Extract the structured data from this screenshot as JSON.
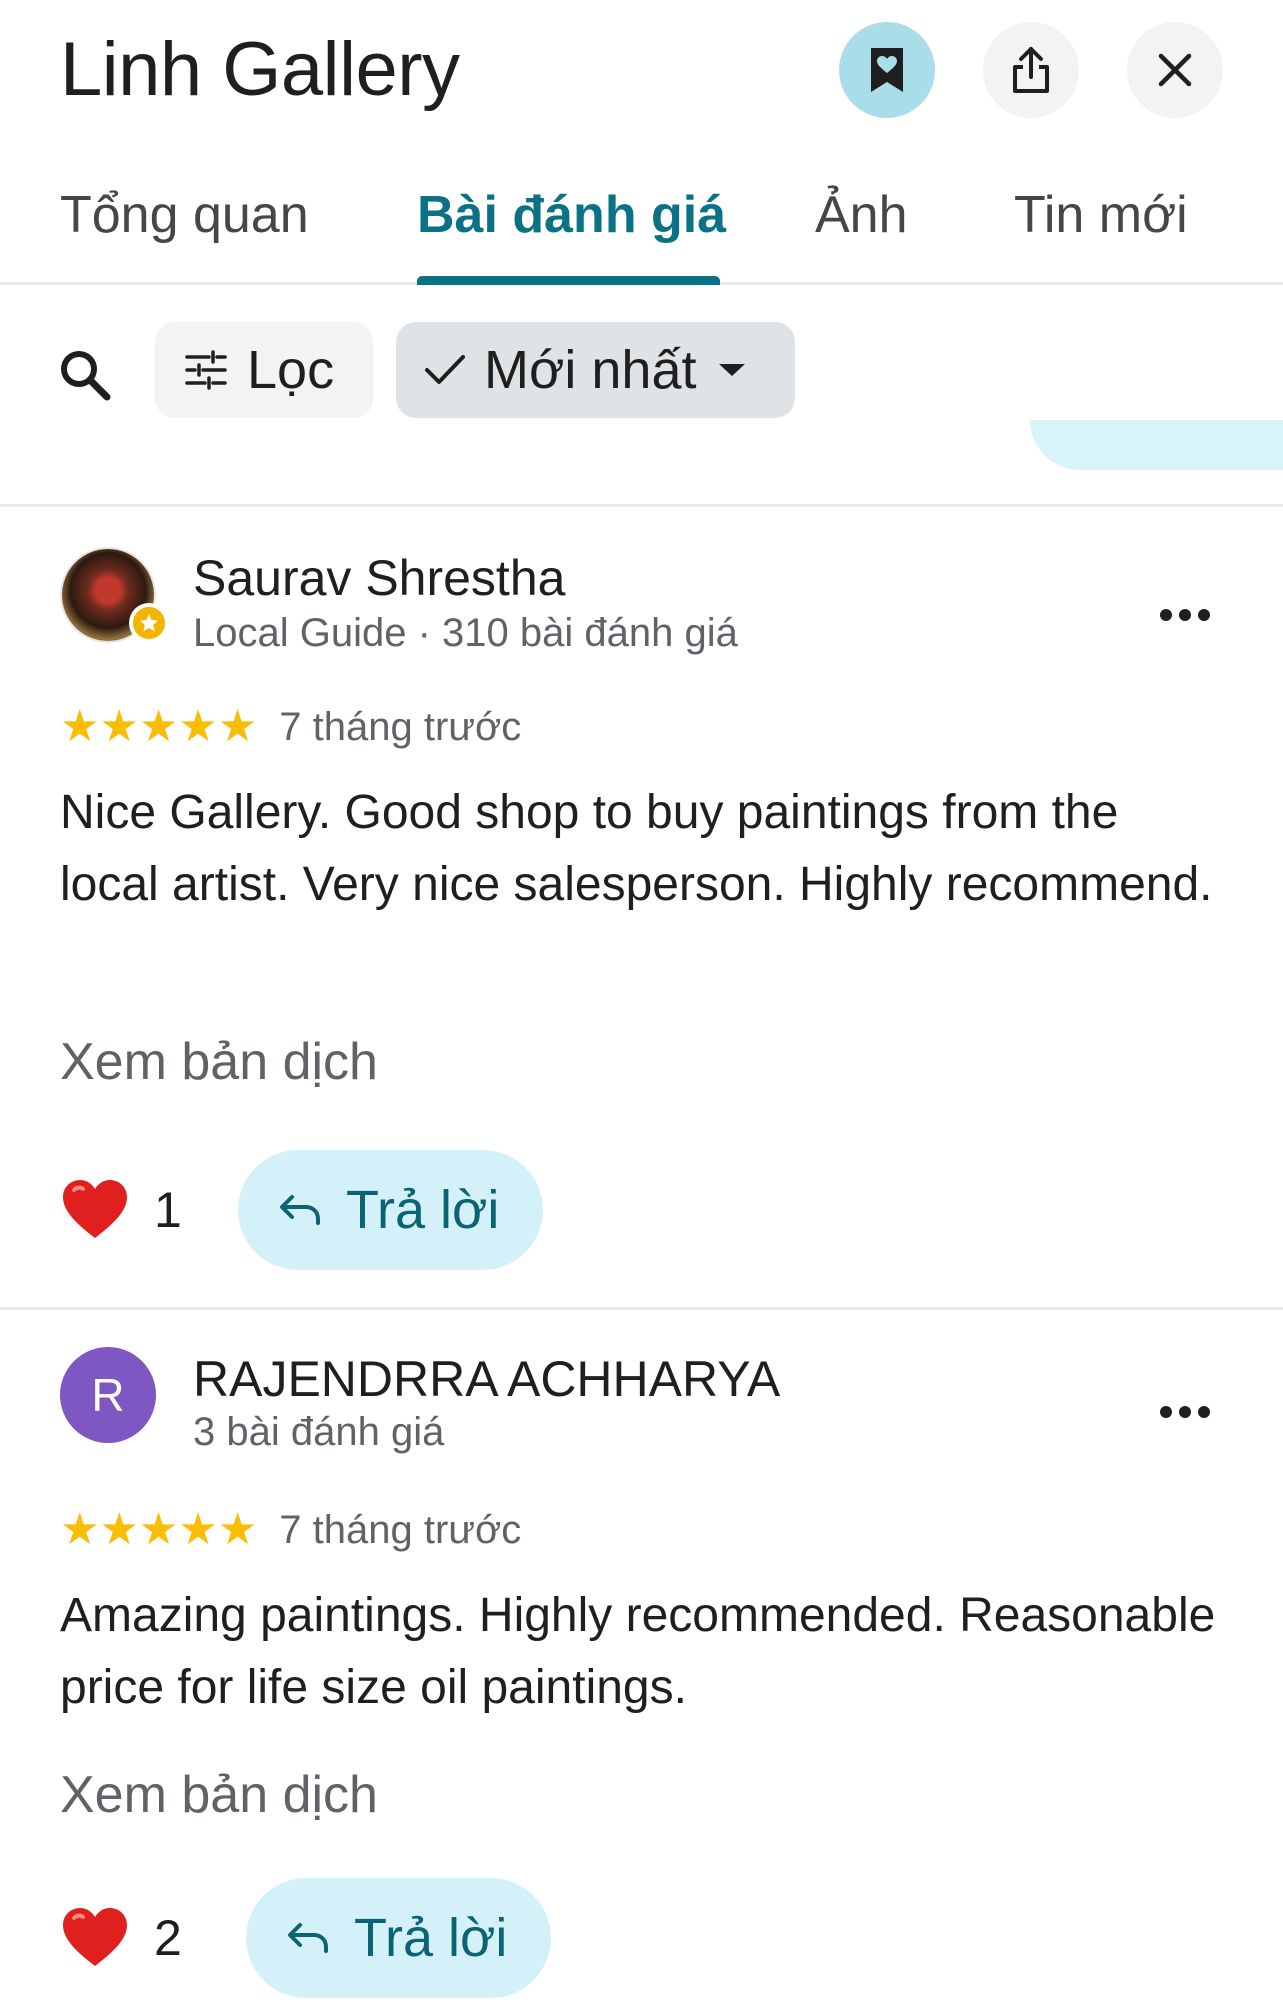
{
  "place": {
    "title": "Linh Gallery"
  },
  "header_icons": {
    "saved": "bookmark-heart-icon",
    "share": "share-icon",
    "close": "close-icon"
  },
  "tabs": [
    {
      "label": "Tổng quan",
      "active": false
    },
    {
      "label": "Bài đánh giá",
      "active": true
    },
    {
      "label": "Ảnh",
      "active": false
    },
    {
      "label": "Tin mới",
      "active": false
    }
  ],
  "filters": {
    "search_icon": "search-icon",
    "filter_label": "Lọc",
    "sort_label": "Mới nhất",
    "sort_selected": true
  },
  "reviews": [
    {
      "author": "Saurav Shrestha",
      "meta": "Local Guide · 310 bài đánh giá",
      "avatar_type": "photo",
      "local_guide": true,
      "rating": 5,
      "date": "7 tháng trước",
      "text": "Nice Gallery. Good shop to buy paintings from the local artist. Very nice salesperson. Highly recommend.",
      "translate_label": "Xem bản dịch",
      "likes": "1",
      "reply_label": "Trả lời"
    },
    {
      "author": "RAJENDRRA ACHHARYA",
      "meta": "3 bài đánh giá",
      "avatar_type": "letter",
      "avatar_letter": "R",
      "local_guide": false,
      "rating": 5,
      "date": "7 tháng trước",
      "text": "Amazing paintings. Highly recommended. Reasonable price for life size oil paintings.",
      "translate_label": "Xem bản dịch",
      "likes": "2",
      "reply_label": "Trả lời"
    }
  ],
  "colors": {
    "accent": "#0b7285",
    "saved_button": "#a8dde9",
    "reply_button": "#d4f1f9",
    "star": "#fbbc04",
    "avatar_purple": "#7e57c2"
  }
}
